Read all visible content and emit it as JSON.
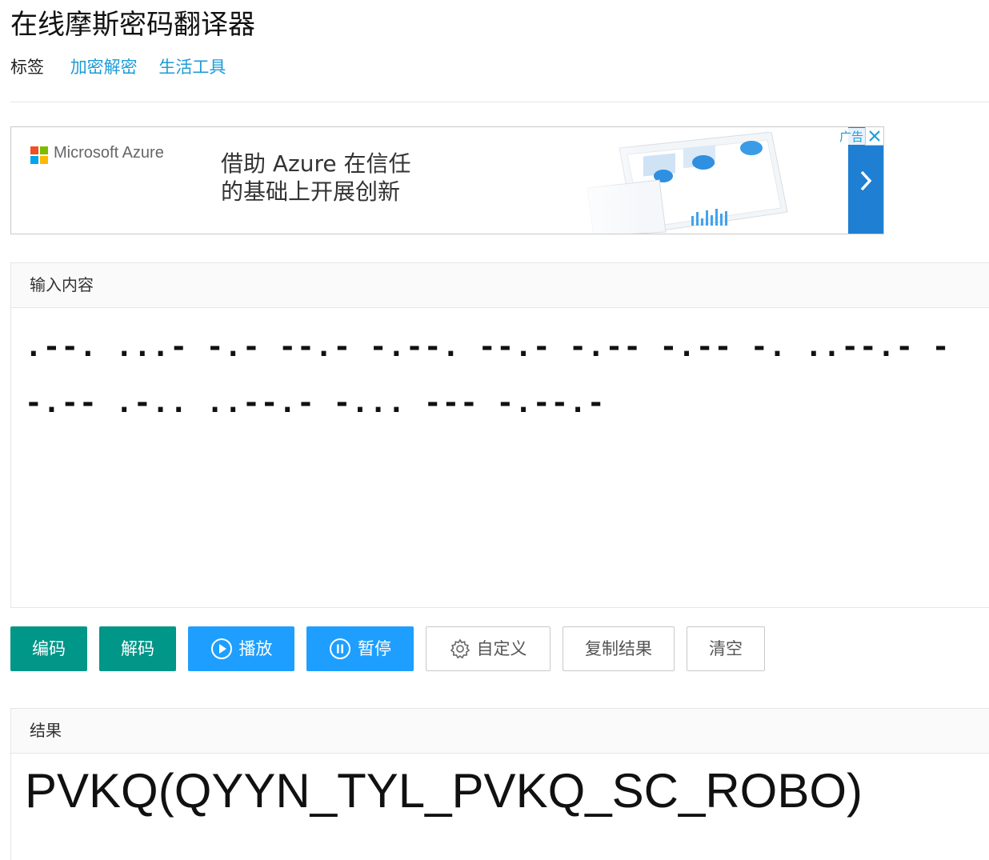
{
  "page": {
    "title": "在线摩斯密码翻译器",
    "tags_label": "标签",
    "tags": [
      "加密解密",
      "生活工具"
    ]
  },
  "ad": {
    "brand": "Microsoft Azure",
    "headline_line1": "借助 Azure 在信任",
    "headline_line2": "的基础上开展创新",
    "ad_label": "广告",
    "icons": [
      "microsoft-logo-icon",
      "chevron-right-icon",
      "close-icon"
    ],
    "colors": {
      "ms_red": "#f25022",
      "ms_green": "#7fba00",
      "ms_blue": "#00a4ef",
      "ms_yellow": "#ffb900",
      "button": "#1f7fd2"
    }
  },
  "input": {
    "header": "输入内容",
    "value": ".--. ...- -.- --.- -.--. --.- -.-- -.-- -. ..--.- - -.-- .-.. ..--.- -... --- -.--.-"
  },
  "buttons": {
    "encode": "编码",
    "decode": "解码",
    "play": "播放",
    "pause": "暂停",
    "custom": "自定义",
    "copy": "复制结果",
    "clear": "清空"
  },
  "result": {
    "header": "结果",
    "value": "PVKQ(QYYN_TYL_PVKQ_SC_ROBO)"
  },
  "colors": {
    "green": "#009688",
    "blue": "#1e9fff",
    "link": "#1c9bd6"
  }
}
